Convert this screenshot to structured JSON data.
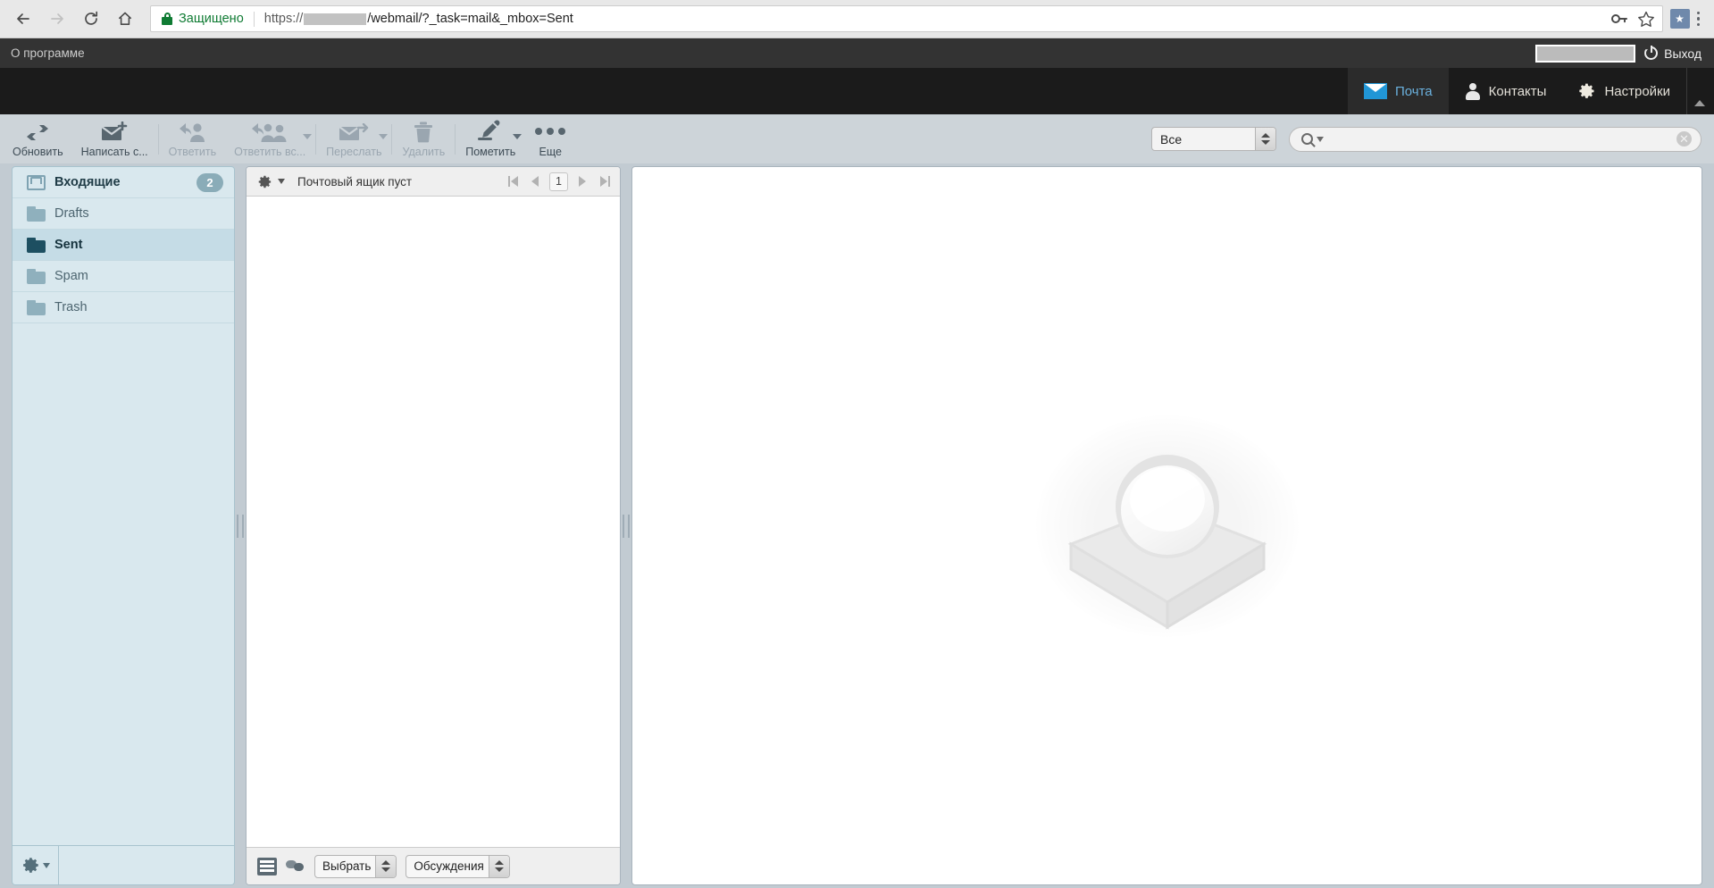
{
  "browser": {
    "back_icon": "back-arrow-icon",
    "forward_icon": "forward-arrow-icon",
    "reload_icon": "reload-icon",
    "home_icon": "home-icon",
    "secure_label": "Защищено",
    "url_scheme": "https://",
    "url_path": "/webmail/?_task=mail&_mbox=Sent",
    "key_icon": "key-icon",
    "star_icon": "star-icon",
    "extension_badge": "★",
    "menu_icon": "three-dot-menu-icon"
  },
  "topbar": {
    "about_label": "О программе",
    "logout_label": "Выход"
  },
  "tasks": [
    {
      "label": "Почта",
      "icon": "mail-icon",
      "active": true
    },
    {
      "label": "Контакты",
      "icon": "contacts-icon",
      "active": false
    },
    {
      "label": "Настройки",
      "icon": "settings-gear-icon",
      "active": false
    }
  ],
  "toolbar": {
    "buttons": [
      {
        "label": "Обновить",
        "icon": "refresh-icon",
        "disabled": false,
        "caret": false
      },
      {
        "label": "Написать с...",
        "icon": "compose-icon",
        "disabled": false,
        "caret": false
      },
      {
        "label": "Ответить",
        "icon": "reply-icon",
        "disabled": true,
        "caret": false
      },
      {
        "label": "Ответить вс...",
        "icon": "reply-all-icon",
        "disabled": true,
        "caret": true
      },
      {
        "label": "Переслать",
        "icon": "forward-mail-icon",
        "disabled": true,
        "caret": true
      },
      {
        "label": "Удалить",
        "icon": "trash-icon",
        "disabled": true,
        "caret": false
      },
      {
        "label": "Пометить",
        "icon": "mark-pen-icon",
        "disabled": false,
        "caret": true
      },
      {
        "label": "Еще",
        "icon": "more-dots-icon",
        "disabled": false,
        "caret": false
      }
    ],
    "scope_value": "Все",
    "search_placeholder": "",
    "search_value": ""
  },
  "folders": [
    {
      "label": "Входящие",
      "icon": "inbox-icon",
      "badge": "2",
      "selected": false,
      "unread": true
    },
    {
      "label": "Drafts",
      "icon": "folder-icon",
      "badge": "",
      "selected": false,
      "unread": false
    },
    {
      "label": "Sent",
      "icon": "folder-icon",
      "badge": "",
      "selected": true,
      "unread": false
    },
    {
      "label": "Spam",
      "icon": "folder-icon",
      "badge": "",
      "selected": false,
      "unread": false
    },
    {
      "label": "Trash",
      "icon": "folder-icon",
      "badge": "",
      "selected": false,
      "unread": false
    }
  ],
  "folder_footer": {
    "settings_icon": "folder-settings-gear-icon"
  },
  "message_list": {
    "options_icon": "list-options-gear-icon",
    "status_text": "Почтовый ящик пуст",
    "pager": {
      "first_icon": "first-page-icon",
      "prev_icon": "prev-page-icon",
      "page": "1",
      "next_icon": "next-page-icon",
      "last_icon": "last-page-icon"
    },
    "footer": {
      "list_mode_icon": "list-view-icon",
      "thread_mode_icon": "threads-view-icon",
      "select_label": "Выбрать",
      "threads_label": "Обсуждения"
    }
  },
  "preview": {
    "watermark_icon": "roundcube-watermark-logo"
  },
  "colors": {
    "topbar_bg": "#333333",
    "nav_bg": "#1b1b1b",
    "toolbar_bg": "#cdd4d9",
    "main_bg": "#c2cbd2",
    "folder_bg": "#d9e8ee",
    "folder_selected_bg": "#c5dce6",
    "accent_blue": "#6ab0dd",
    "mail_icon_blue": "#2196d6",
    "secure_green": "#0f7b33"
  }
}
